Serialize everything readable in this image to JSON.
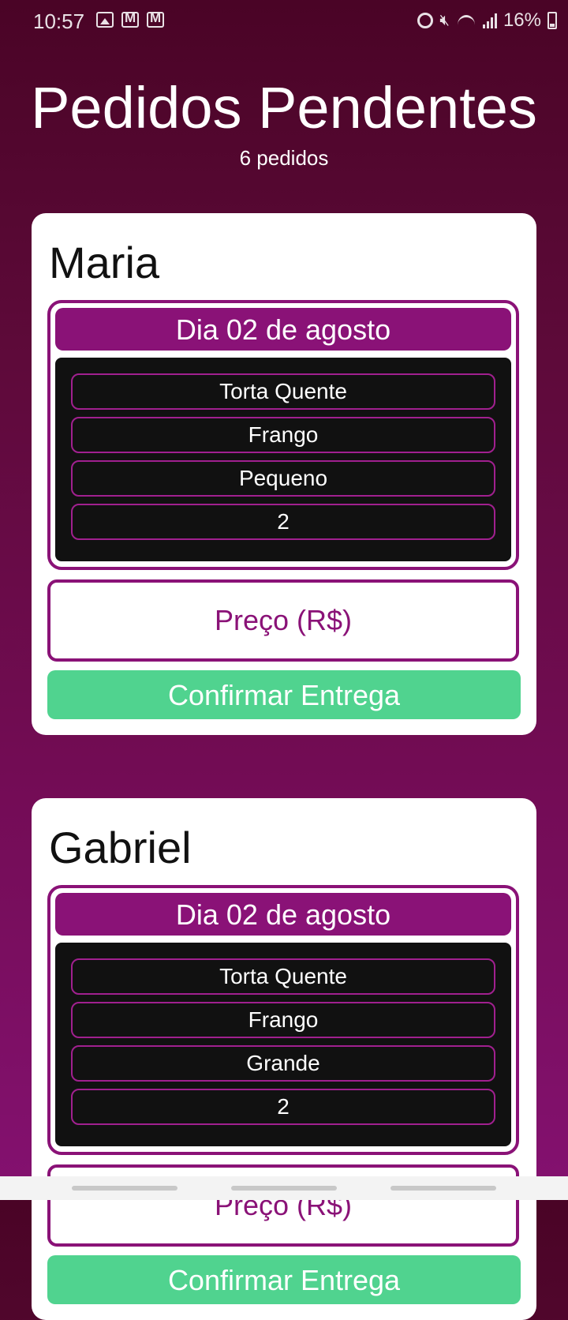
{
  "status_bar": {
    "time": "10:57",
    "left_icons": [
      "gallery-icon",
      "gmail-icon",
      "gmail-icon"
    ],
    "right_icons": [
      "alarm-icon",
      "mute-icon",
      "wifi-icon",
      "signal-icon"
    ],
    "battery_text": "16%"
  },
  "header": {
    "title": "Pedidos Pendentes",
    "count": "6 pedidos"
  },
  "orders": [
    {
      "customer": "Maria",
      "date": "Dia 02 de agosto",
      "items": [
        "Torta Quente",
        "Frango",
        "Pequeno",
        "2"
      ],
      "price_placeholder": "Preço (R$)",
      "confirm_label": "Confirmar Entrega"
    },
    {
      "customer": "Gabriel",
      "date": "Dia 02 de agosto",
      "items": [
        "Torta Quente",
        "Frango",
        "Grande",
        "2"
      ],
      "price_placeholder": "Preço (R$)",
      "confirm_label": "Confirmar Entrega"
    }
  ],
  "colors": {
    "accent": "#8a1277",
    "confirm": "#50d38f",
    "item_bg": "#111111"
  }
}
